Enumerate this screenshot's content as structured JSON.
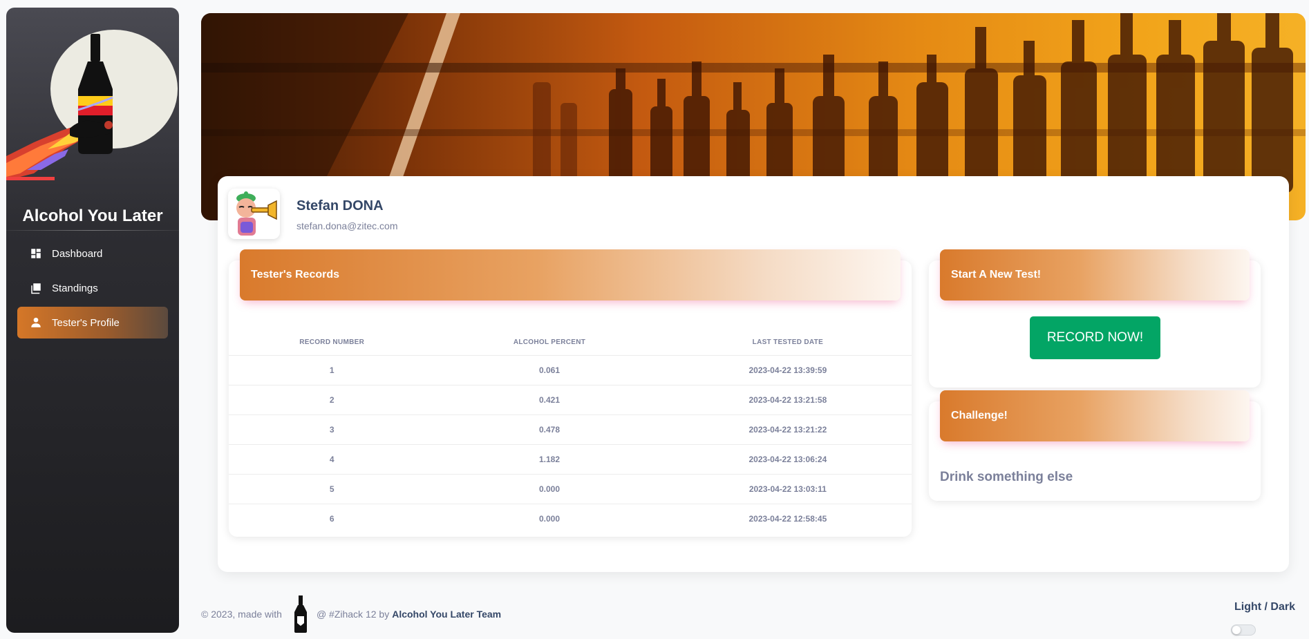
{
  "sidebar": {
    "brand": "Alcohol You Later",
    "items": [
      {
        "label": "Dashboard",
        "icon": "dashboard-icon"
      },
      {
        "label": "Standings",
        "icon": "standings-icon"
      },
      {
        "label": "Tester's Profile",
        "icon": "person-icon",
        "active": true
      }
    ]
  },
  "profile": {
    "name": "Stefan DONA",
    "email": "stefan.dona@zitec.com"
  },
  "records": {
    "title": "Tester's Records",
    "columns": [
      "Record Number",
      "Alcohol Percent",
      "Last Tested Date"
    ],
    "rows": [
      {
        "num": "1",
        "percent": "0.061",
        "date": "2023-04-22 13:39:59"
      },
      {
        "num": "2",
        "percent": "0.421",
        "date": "2023-04-22 13:21:58"
      },
      {
        "num": "3",
        "percent": "0.478",
        "date": "2023-04-22 13:21:22"
      },
      {
        "num": "4",
        "percent": "1.182",
        "date": "2023-04-22 13:06:24"
      },
      {
        "num": "5",
        "percent": "0.000",
        "date": "2023-04-22 13:03:11"
      },
      {
        "num": "6",
        "percent": "0.000",
        "date": "2023-04-22 12:58:45"
      }
    ]
  },
  "test": {
    "title": "Start A New Test!",
    "button": "RECORD NOW!"
  },
  "challenge": {
    "title": "Challenge!",
    "text": "Drink something else"
  },
  "footer": {
    "prefix": "© 2023, made with",
    "middle": "@ #Zihack 12 by",
    "team": "Alcohol You Later Team"
  },
  "theme": {
    "label": "Light / Dark"
  },
  "colors": {
    "accent": "#d57728",
    "button": "#03a565",
    "text": "#344767",
    "muted": "#7b809a"
  }
}
